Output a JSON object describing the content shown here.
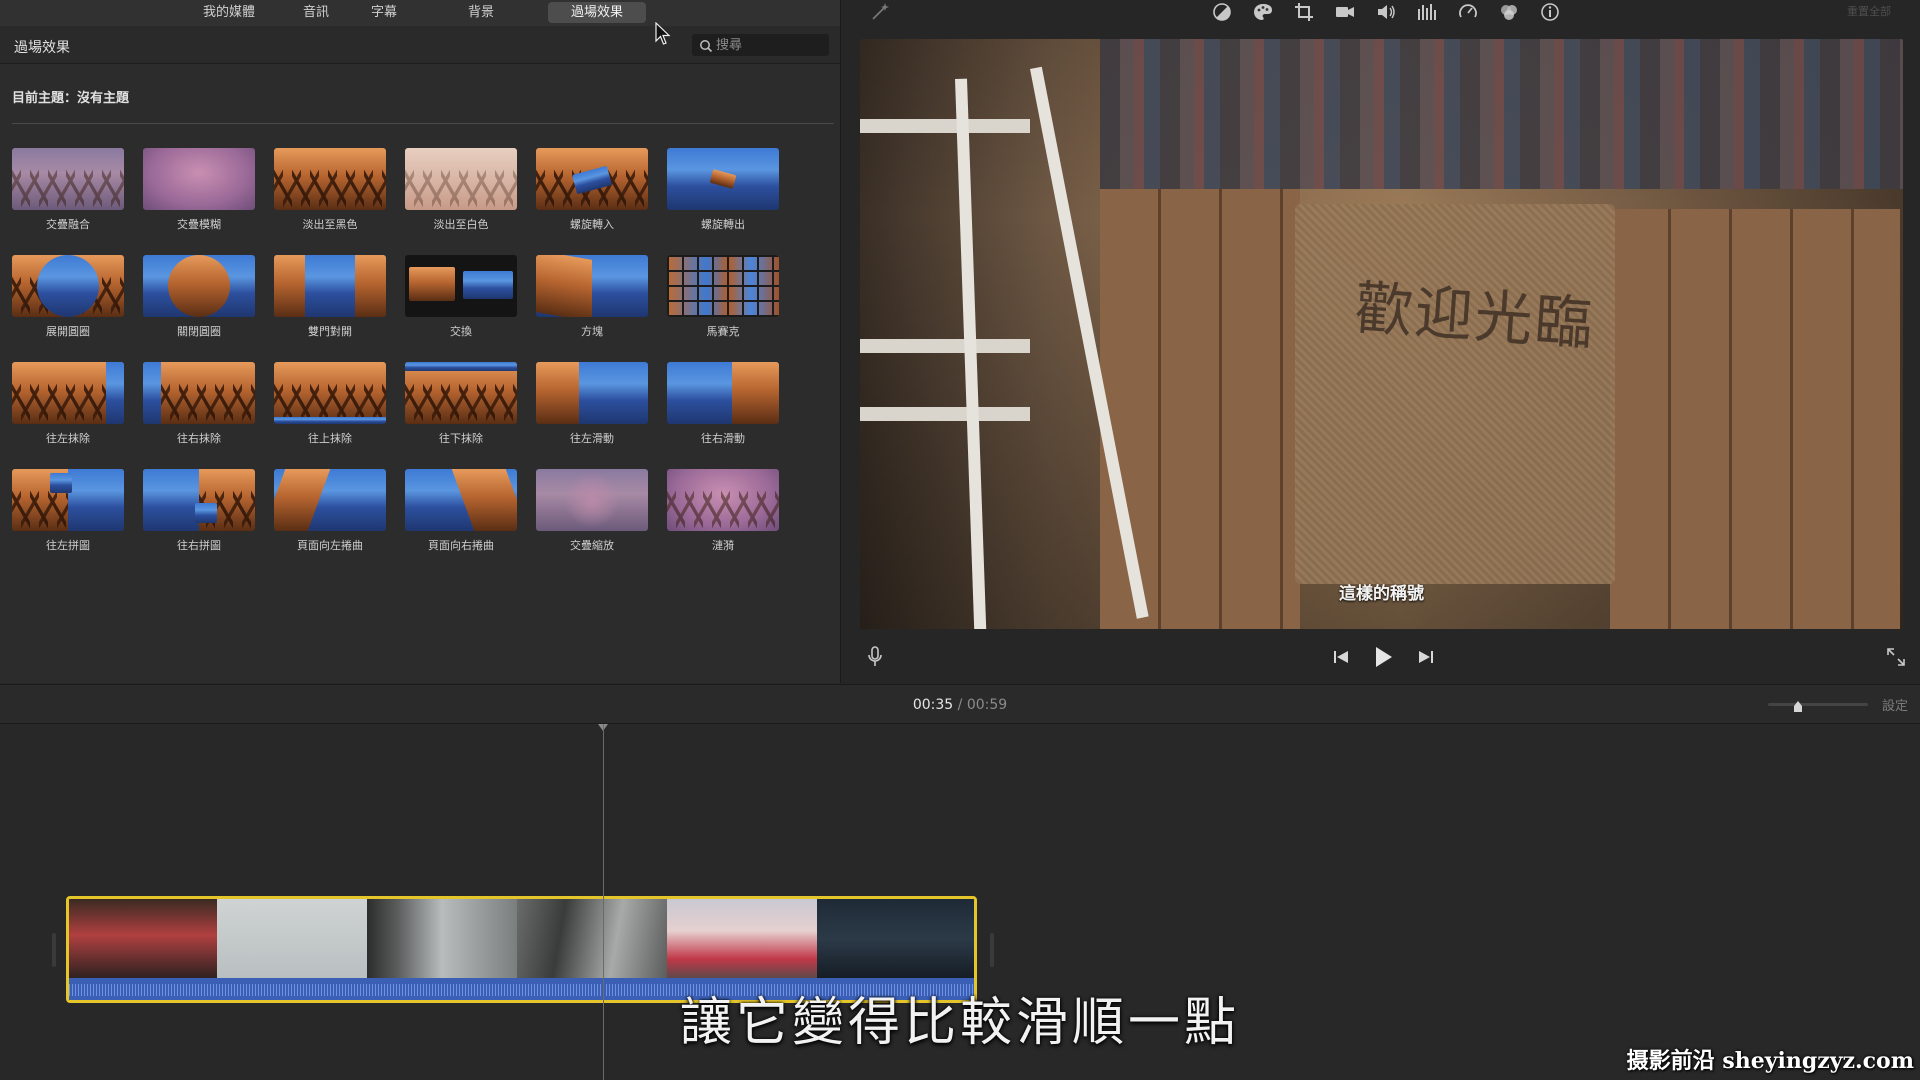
{
  "browser": {
    "tabs": [
      {
        "label": "我的媒體",
        "active": false
      },
      {
        "label": "音訊",
        "active": false
      },
      {
        "label": "字幕",
        "active": false
      },
      {
        "label": "背景",
        "active": false
      },
      {
        "label": "過場效果",
        "active": true
      }
    ],
    "title": "過場效果",
    "search_placeholder": "搜尋",
    "theme_label": "目前主題：沒有主題",
    "transitions": [
      "交疊融合",
      "交疊模糊",
      "淡出至黑色",
      "淡出至白色",
      "螺旋轉入",
      "螺旋轉出",
      "展開圓圈",
      "關閉圓圈",
      "雙門對開",
      "交換",
      "方塊",
      "馬賽克",
      "往左抹除",
      "往右抹除",
      "往上抹除",
      "往下抹除",
      "往左滑動",
      "往右滑動",
      "往左拼圖",
      "往右拼圖",
      "頁面向左捲曲",
      "頁面向右捲曲",
      "交疊縮放",
      "漣漪"
    ]
  },
  "viewer": {
    "toolbar_icons": [
      "magic-wand-icon",
      "color-balance-icon",
      "color-correction-icon",
      "crop-icon",
      "stabilization-icon",
      "volume-icon",
      "equalizer-icon",
      "speed-icon",
      "filter-icon",
      "info-icon"
    ],
    "reset_all_label": "重置全部",
    "sign_text": "歡迎光臨",
    "subtitle": "這樣的稱號"
  },
  "timeline": {
    "current_time": "00:35",
    "separator": "/",
    "total_time": "00:59",
    "settings_label": "設定",
    "zoom_level": 0.3
  },
  "overlay": {
    "caption": "讓它變得比較滑順一點",
    "watermark": "摄影前沿 sheyingzyz.com"
  }
}
